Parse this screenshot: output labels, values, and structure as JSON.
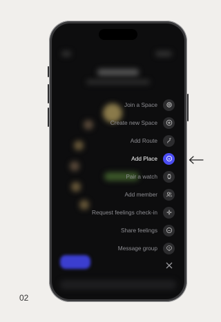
{
  "menu": {
    "items": [
      {
        "label": "Join a Space",
        "icon": "orbit-icon"
      },
      {
        "label": "Create new Space",
        "icon": "plus-circle-icon"
      },
      {
        "label": "Add Route",
        "icon": "route-icon"
      },
      {
        "label": "Add Place",
        "icon": "place-icon",
        "active": true
      },
      {
        "label": "Pair a watch",
        "icon": "watch-icon"
      },
      {
        "label": "Add member",
        "icon": "members-icon"
      },
      {
        "label": "Request feelings check-in",
        "icon": "sparkle-icon"
      },
      {
        "label": "Share feelings",
        "icon": "emoji-icon"
      },
      {
        "label": "Message group",
        "icon": "message-icon"
      }
    ]
  },
  "page_number": "02",
  "colors": {
    "accent": "#4b4df2",
    "background": "#f1efec",
    "screen": "#0d0d0e"
  }
}
